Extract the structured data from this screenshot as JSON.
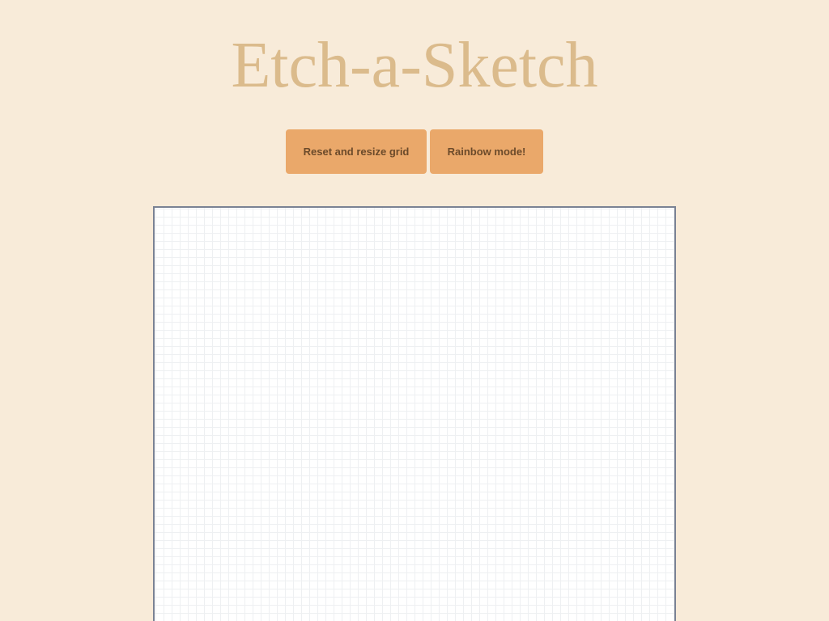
{
  "page": {
    "title": "Etch-a-Sketch"
  },
  "controls": {
    "reset_label": "Reset and resize grid",
    "rainbow_label": "Rainbow mode!"
  },
  "colors": {
    "background": "#f8ebd9",
    "title": "#dbbb8c",
    "button": "#eaa86a",
    "button_text": "#6b4a2a",
    "grid_border": "#7a8294",
    "grid_line": "#eef0f2"
  }
}
